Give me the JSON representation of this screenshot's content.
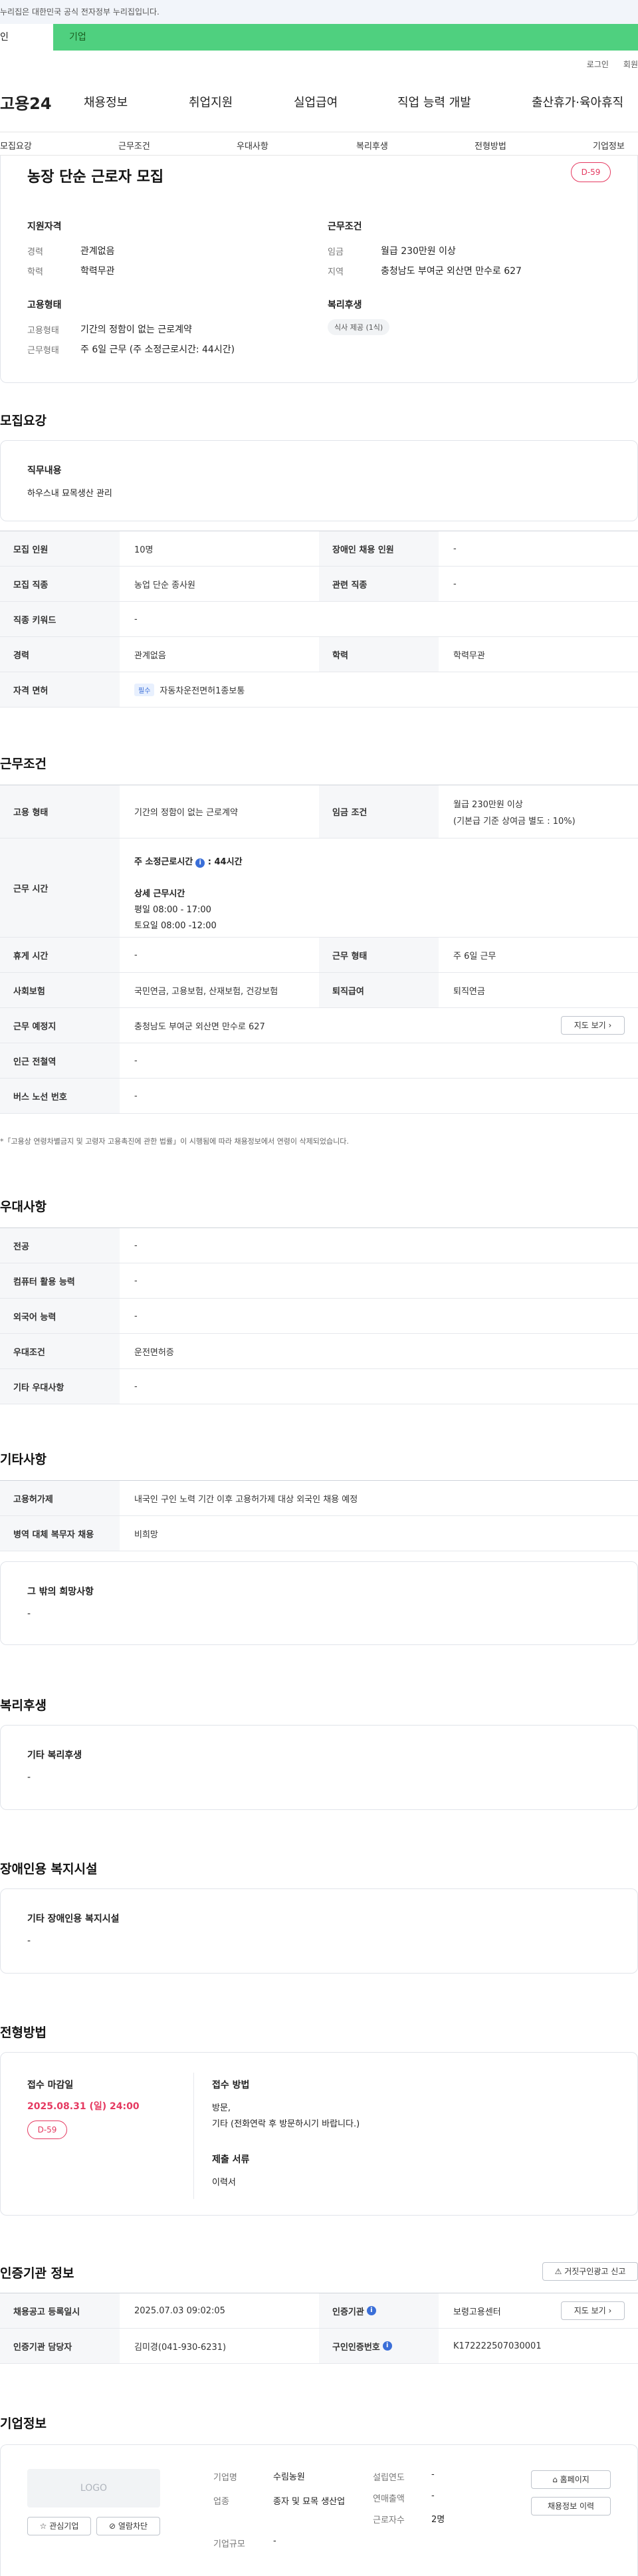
{
  "gov_banner": "누리집은 대한민국 공식 전자정부 누리집입니다.",
  "top_tabs": [
    "인",
    "기업"
  ],
  "util": {
    "login": "로그인",
    "join": "회원"
  },
  "gnb": {
    "logo": "고용24",
    "items": [
      "채용정보",
      "취업지원",
      "실업급여",
      "직업 능력 개발",
      "출산휴가·육아휴직"
    ]
  },
  "subnav": [
    "모집요강",
    "근무조건",
    "우대사항",
    "복리후생",
    "전형방법",
    "기업정보"
  ],
  "summary": {
    "title": "농장 단순 근로자 모집",
    "dday": "D-59",
    "qual": {
      "heading": "지원자격",
      "career_label": "경력",
      "career": "관계없음",
      "edu_label": "학력",
      "edu": "학력무관"
    },
    "cond": {
      "heading": "근무조건",
      "wage_label": "임금",
      "wage": "월급 230만원 이상",
      "region_label": "지역",
      "region": "충청남도 부여군 외산면 만수로 627"
    },
    "employ": {
      "heading": "고용형태",
      "type_label": "고용형태",
      "type": "기간의 정함이 없는 근로계약",
      "days_label": "근무형태",
      "days": "주 6일 근무 (주 소정근로시간: 44시간)"
    },
    "welfare": {
      "heading": "복리후생",
      "chip": "식사 제공 (1식)"
    }
  },
  "recruit": {
    "heading": "모집요강",
    "duty_label": "직무내용",
    "duty": "하우스내 묘목생산 관리",
    "rows": [
      {
        "l1": "모집 인원",
        "v1": "10명",
        "l2": "장애인 채용 인원",
        "v2": "-"
      },
      {
        "l1": "모집 직종",
        "v1": "농업 단순 종사원",
        "l2": "관련 직종",
        "v2": "-"
      },
      {
        "l1": "직종 키워드",
        "v1": "-"
      },
      {
        "l1": "경력",
        "v1": "관계없음",
        "l2": "학력",
        "v2": "학력무관"
      },
      {
        "l1": "자격 면허",
        "tag": "필수",
        "v1": "자동차운전면허1종보통"
      }
    ]
  },
  "work": {
    "heading": "근무조건",
    "type_label": "고용 형태",
    "type": "기간의 정함이 없는 근로계약",
    "wage_label": "임금 조건",
    "wage1": "월급 230만원 이상",
    "wage2": "(기본급 기준 상여금 별도 : 10%)",
    "hours_label": "근무 시간",
    "hours_title": "주 소정근로시간",
    "hours_total": "44시간",
    "hours_detail_label": "상세 근무시간",
    "hours_weekday": "평일 08:00 - 17:00",
    "hours_sat": "토요일 08:00 -12:00",
    "rest_label": "휴게 시간",
    "rest": "-",
    "form_label": "근무 형태",
    "form": "주 6일 근무",
    "ins_label": "사회보험",
    "ins": "국민연금, 고용보험, 산재보험, 건강보험",
    "sev_label": "퇴직급여",
    "sev": "퇴직연금",
    "place_label": "근무 예정지",
    "place": "충청남도 부여군 외산면 만수로 627",
    "map_btn": "지도 보기",
    "subway_label": "인근 전철역",
    "subway": "-",
    "bus_label": "버스 노선 번호",
    "bus": "-",
    "note": "*「고용상 연령차별금지 및 고령자 고용촉진에 관한 법률」이 시행됨에 따라 채용정보에서 연령이 삭제되었습니다."
  },
  "pref": {
    "heading": "우대사항",
    "rows": [
      {
        "l": "전공",
        "v": "-"
      },
      {
        "l": "컴퓨터 활용 능력",
        "v": "-"
      },
      {
        "l": "외국어 능력",
        "v": "-"
      },
      {
        "l": "우대조건",
        "v": "운전면허증"
      },
      {
        "l": "기타 우대사항",
        "v": "-"
      }
    ]
  },
  "etc": {
    "heading": "기타사항",
    "rows": [
      {
        "l": "고용허가제",
        "v": "내국인 구인 노력 기간 이후 고용허가제 대상 외국인 채용 예정"
      },
      {
        "l": "병역 대체 복무자 채용",
        "v": "비희망"
      }
    ],
    "other_label": "그 밖의 희망사항",
    "other": "-"
  },
  "benefit": {
    "heading": "복리후생",
    "label": "기타 복리후생",
    "value": "-"
  },
  "disabled": {
    "heading": "장애인용 복지시설",
    "label": "기타 장애인용 복지시설",
    "value": "-"
  },
  "apply": {
    "heading": "전형방법",
    "deadline_label": "접수 마감일",
    "deadline": "2025.08.31 (일) 24:00",
    "dday": "D-59",
    "method_label": "접수 방법",
    "method1": "방문,",
    "method2": "기타 (전화연락 후 방문하시기 바랍니다.)",
    "docs_label": "제출 서류",
    "docs": "이력서"
  },
  "cert": {
    "heading": "인증기관 정보",
    "report_btn": "거짓구인광고 신고",
    "reg_label": "채용공고 등록일시",
    "reg": "2025.07.03 09:02:05",
    "org_label": "인증기관",
    "org": "보령고용센터",
    "map_btn": "지도 보기",
    "mgr_label": "인증기관 담당자",
    "mgr": "김미경(041-930-6231)",
    "num_label": "구인인증번호",
    "num": "K172222507030001"
  },
  "company": {
    "heading": "기업정보",
    "logo": "LOGO",
    "fav_btn": "관심기업",
    "block_btn": "열람차단",
    "name_label": "기업명",
    "name": "수림농원",
    "industry_label": "업종",
    "industry": "종자 및 묘목 생산업",
    "size_label": "기업규모",
    "size": "-",
    "year_label": "설립연도",
    "year": "-",
    "sales_label": "연매출액",
    "sales": "-",
    "emp_label": "근로자수",
    "emp": "2명",
    "home_btn": "홈페이지",
    "hist_btn": "채용정보 이력"
  }
}
